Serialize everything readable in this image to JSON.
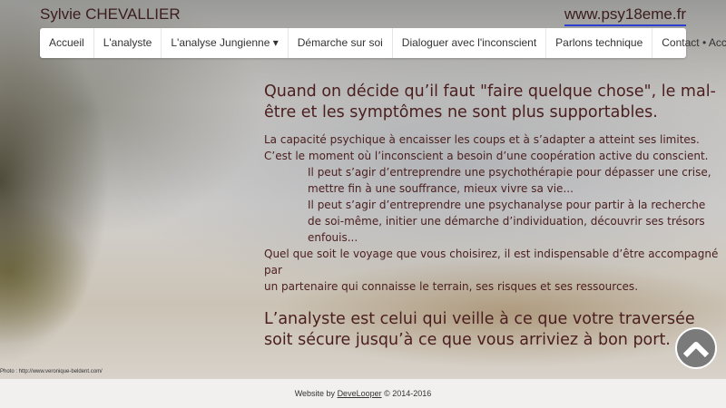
{
  "header": {
    "title": "Sylvie CHEVALLIER",
    "site": "www.psy18eme.fr"
  },
  "nav": [
    "Accueil",
    "L'analyste",
    "L'analyse Jungienne ▾",
    "Démarche sur soi",
    "Dialoguer avec l'inconscient",
    "Parlons technique",
    "Contact • Accès"
  ],
  "content": {
    "heading1": [
      "Quand on décide qu’il faut \"faire quelque chose\", le mal-",
      "être et les symptômes ne sont plus supportables."
    ],
    "lines": [
      "La capacité psychique à encaisser les coups et à s’adapter a atteint ses limites.",
      "C’est le moment où l’inconscient a besoin d’une coopération active du conscient."
    ],
    "indented": [
      "Il peut s’agir d’entreprendre une psychothérapie pour dépasser une crise,",
      "mettre fin à une souffrance, mieux vivre sa vie...",
      "Il peut s’agir d’entreprendre une psychanalyse pour partir à la recherche",
      "de soi-même, initier une démarche d’individuation, découvrir ses trésors",
      "enfouis..."
    ],
    "closing": [
      "Quel que soit le voyage que vous choisirez, il est indispensable d’être accompagné par",
      "un partenaire qui connaisse le terrain, ses risques et ses ressources."
    ],
    "heading2": [
      "L’analyste est celui qui veille à ce que votre traversée",
      "soit sécure jusqu’à ce que vous arriviez à bon port."
    ]
  },
  "photo_credit": "Photo : http://www.veronique-beldent.com/",
  "footer": {
    "prefix": "Website by ",
    "link": "DeveLooper",
    "suffix": " © 2014-2016"
  },
  "icons": {
    "back_to_top": "chevron-up-circle-icon"
  }
}
